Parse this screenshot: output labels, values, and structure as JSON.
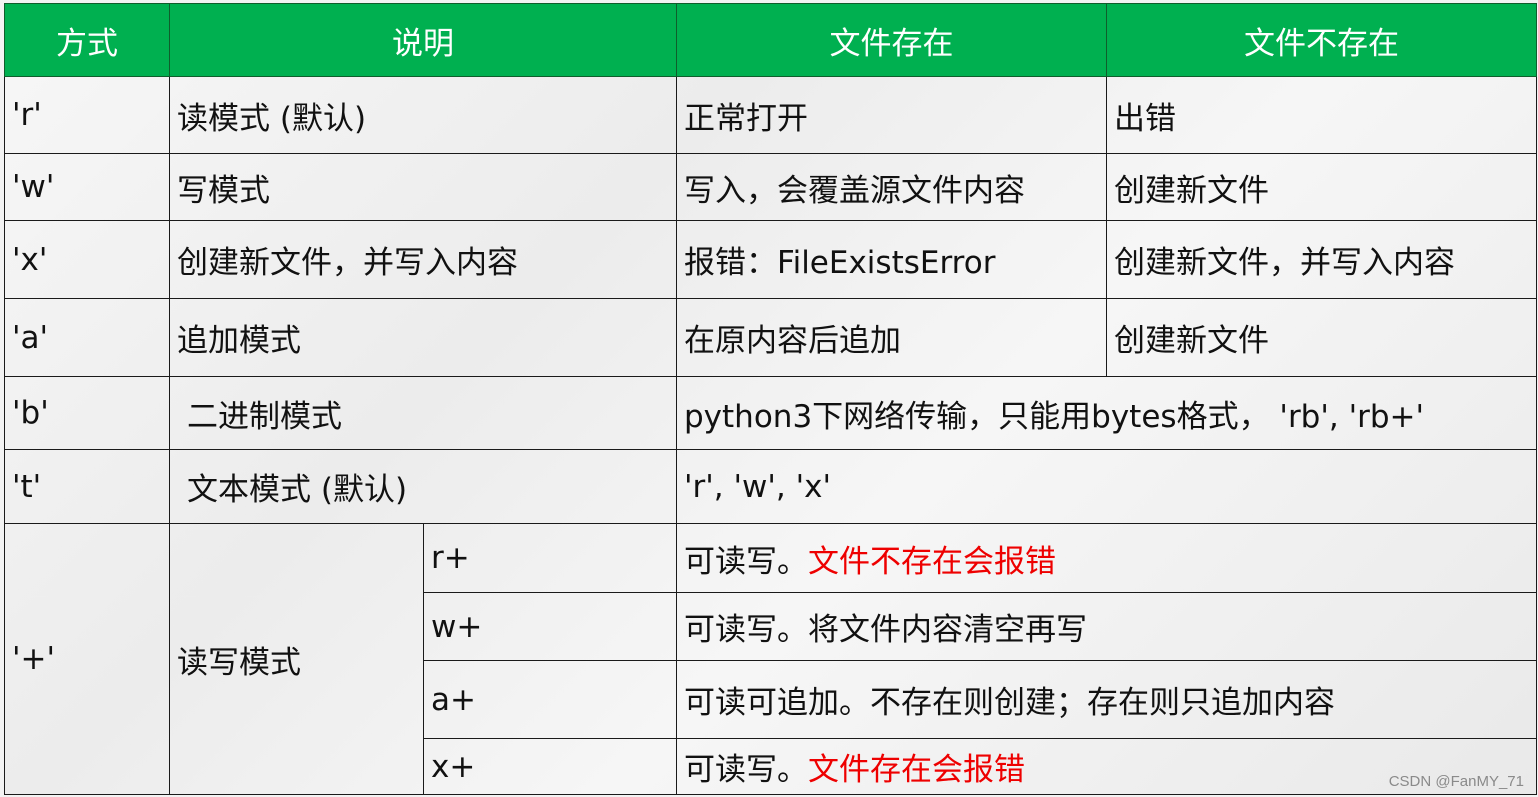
{
  "headers": [
    "方式",
    "说明",
    "文件存在",
    "文件不存在"
  ],
  "rows": {
    "r": {
      "mode": "'r'",
      "desc": "读模式 (默认)",
      "exists": "正常打开",
      "not_exists": "出错"
    },
    "w": {
      "mode": "'w'",
      "desc": "写模式",
      "exists": "写入，会覆盖源文件内容",
      "not_exists": "创建新文件"
    },
    "x": {
      "mode": "'x'",
      "desc": "创建新文件，并写入内容",
      "exists": "报错：FileExistsError",
      "not_exists": "创建新文件，并写入内容"
    },
    "a": {
      "mode": "'a'",
      "desc": "追加模式",
      "exists": "在原内容后追加",
      "not_exists": "创建新文件"
    },
    "b": {
      "mode": "'b'",
      "desc": "二进制模式",
      "note": "python3下网络传输，只能用bytes格式， 'rb', 'rb+'"
    },
    "t": {
      "mode": "'t'",
      "desc": "文本模式 (默认)",
      "note": "'r', 'w', 'x'"
    }
  },
  "plus": {
    "mode": "'+'",
    "desc": "读写模式",
    "subrows": [
      {
        "code": "r+",
        "text": "可读写。",
        "text_red": "文件不存在会报错"
      },
      {
        "code": "w+",
        "text": "可读写。将文件内容清空再写",
        "text_red": ""
      },
      {
        "code": "a+",
        "text": "可读可追加。不存在则创建；存在则只追加内容",
        "text_red": ""
      },
      {
        "code": "x+",
        "text": "可读写。",
        "text_red": "文件存在会报错"
      }
    ]
  },
  "watermark": "CSDN @FanMY_71",
  "colors": {
    "header_bg": "#00b050",
    "error_text": "#ee0000"
  }
}
